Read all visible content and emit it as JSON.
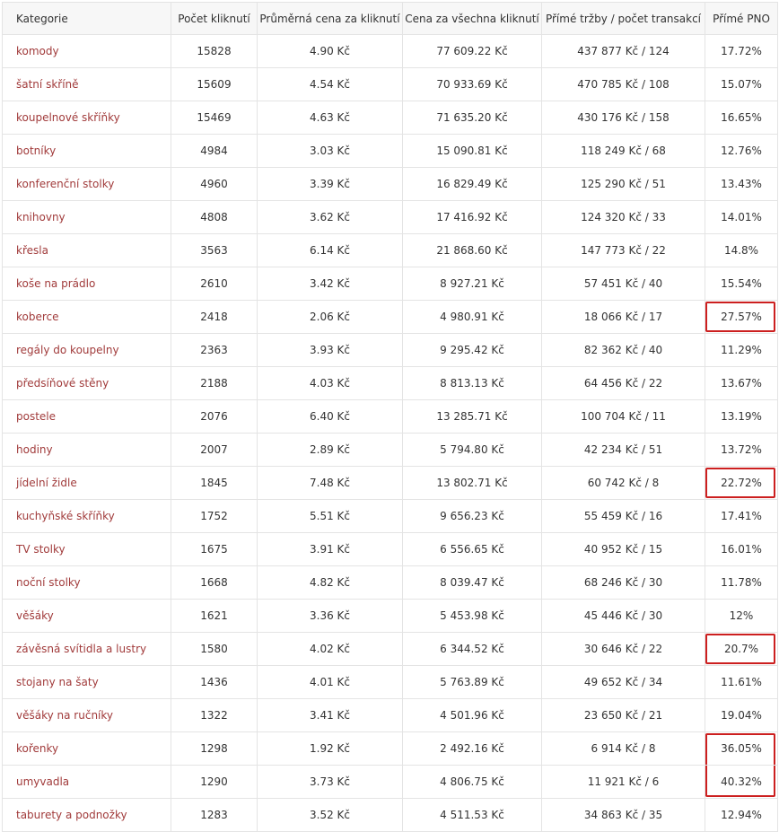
{
  "table": {
    "headers": [
      "Kategorie",
      "Počet kliknutí",
      "Průměrná cena za kliknutí",
      "Cena za všechna kliknutí",
      "Přímé tržby / počet transakcí",
      "Přímé PNO"
    ],
    "highlight_color": "#cc1f1f",
    "link_color": "#a13b3b",
    "rows": [
      {
        "category": "komody",
        "clicks": "15828",
        "avg_cpc": "4.90 Kč",
        "total_cost": "77 609.22 Kč",
        "revenue": "437 877 Kč / 124",
        "pno": "17.72%",
        "highlight": "none"
      },
      {
        "category": "šatní skříně",
        "clicks": "15609",
        "avg_cpc": "4.54 Kč",
        "total_cost": "70 933.69 Kč",
        "revenue": "470 785 Kč / 108",
        "pno": "15.07%",
        "highlight": "none"
      },
      {
        "category": "koupelnové skříňky",
        "clicks": "15469",
        "avg_cpc": "4.63 Kč",
        "total_cost": "71 635.20 Kč",
        "revenue": "430 176 Kč / 158",
        "pno": "16.65%",
        "highlight": "none"
      },
      {
        "category": "botníky",
        "clicks": "4984",
        "avg_cpc": "3.03 Kč",
        "total_cost": "15 090.81 Kč",
        "revenue": "118 249 Kč / 68",
        "pno": "12.76%",
        "highlight": "none"
      },
      {
        "category": "konferenční stolky",
        "clicks": "4960",
        "avg_cpc": "3.39 Kč",
        "total_cost": "16 829.49 Kč",
        "revenue": "125 290 Kč / 51",
        "pno": "13.43%",
        "highlight": "none"
      },
      {
        "category": "knihovny",
        "clicks": "4808",
        "avg_cpc": "3.62 Kč",
        "total_cost": "17 416.92 Kč",
        "revenue": "124 320 Kč / 33",
        "pno": "14.01%",
        "highlight": "none"
      },
      {
        "category": "křesla",
        "clicks": "3563",
        "avg_cpc": "6.14 Kč",
        "total_cost": "21 868.60 Kč",
        "revenue": "147 773 Kč / 22",
        "pno": "14.8%",
        "highlight": "none"
      },
      {
        "category": "koše na prádlo",
        "clicks": "2610",
        "avg_cpc": "3.42 Kč",
        "total_cost": "8 927.21 Kč",
        "revenue": "57 451 Kč / 40",
        "pno": "15.54%",
        "highlight": "none"
      },
      {
        "category": "koberce",
        "clicks": "2418",
        "avg_cpc": "2.06 Kč",
        "total_cost": "4 980.91 Kč",
        "revenue": "18 066 Kč / 17",
        "pno": "27.57%",
        "highlight": "single"
      },
      {
        "category": "regály do koupelny",
        "clicks": "2363",
        "avg_cpc": "3.93 Kč",
        "total_cost": "9 295.42 Kč",
        "revenue": "82 362 Kč / 40",
        "pno": "11.29%",
        "highlight": "none"
      },
      {
        "category": "předsíňové stěny",
        "clicks": "2188",
        "avg_cpc": "4.03 Kč",
        "total_cost": "8 813.13 Kč",
        "revenue": "64 456 Kč / 22",
        "pno": "13.67%",
        "highlight": "none"
      },
      {
        "category": "postele",
        "clicks": "2076",
        "avg_cpc": "6.40 Kč",
        "total_cost": "13 285.71 Kč",
        "revenue": "100 704 Kč / 11",
        "pno": "13.19%",
        "highlight": "none"
      },
      {
        "category": "hodiny",
        "clicks": "2007",
        "avg_cpc": "2.89 Kč",
        "total_cost": "5 794.80 Kč",
        "revenue": "42 234 Kč / 51",
        "pno": "13.72%",
        "highlight": "none"
      },
      {
        "category": "jídelní židle",
        "clicks": "1845",
        "avg_cpc": "7.48 Kč",
        "total_cost": "13 802.71 Kč",
        "revenue": "60 742 Kč / 8",
        "pno": "22.72%",
        "highlight": "single"
      },
      {
        "category": "kuchyňské skříňky",
        "clicks": "1752",
        "avg_cpc": "5.51 Kč",
        "total_cost": "9 656.23 Kč",
        "revenue": "55 459 Kč / 16",
        "pno": "17.41%",
        "highlight": "none"
      },
      {
        "category": "TV stolky",
        "clicks": "1675",
        "avg_cpc": "3.91 Kč",
        "total_cost": "6 556.65 Kč",
        "revenue": "40 952 Kč / 15",
        "pno": "16.01%",
        "highlight": "none"
      },
      {
        "category": "noční stolky",
        "clicks": "1668",
        "avg_cpc": "4.82 Kč",
        "total_cost": "8 039.47 Kč",
        "revenue": "68 246 Kč / 30",
        "pno": "11.78%",
        "highlight": "none"
      },
      {
        "category": "věšáky",
        "clicks": "1621",
        "avg_cpc": "3.36 Kč",
        "total_cost": "5 453.98 Kč",
        "revenue": "45 446 Kč / 30",
        "pno": "12%",
        "highlight": "none"
      },
      {
        "category": "závěsná svítidla a lustry",
        "clicks": "1580",
        "avg_cpc": "4.02 Kč",
        "total_cost": "6 344.52 Kč",
        "revenue": "30 646 Kč / 22",
        "pno": "20.7%",
        "highlight": "single"
      },
      {
        "category": "stojany na šaty",
        "clicks": "1436",
        "avg_cpc": "4.01 Kč",
        "total_cost": "5 763.89 Kč",
        "revenue": "49 652 Kč / 34",
        "pno": "11.61%",
        "highlight": "none"
      },
      {
        "category": "věšáky na ručníky",
        "clicks": "1322",
        "avg_cpc": "3.41 Kč",
        "total_cost": "4 501.96 Kč",
        "revenue": "23 650 Kč / 21",
        "pno": "19.04%",
        "highlight": "none"
      },
      {
        "category": "kořenky",
        "clicks": "1298",
        "avg_cpc": "1.92 Kč",
        "total_cost": "2 492.16 Kč",
        "revenue": "6 914 Kč / 8",
        "pno": "36.05%",
        "highlight": "top"
      },
      {
        "category": "umyvadla",
        "clicks": "1290",
        "avg_cpc": "3.73 Kč",
        "total_cost": "4 806.75 Kč",
        "revenue": "11 921 Kč / 6",
        "pno": "40.32%",
        "highlight": "bottom"
      },
      {
        "category": "taburety a podnožky",
        "clicks": "1283",
        "avg_cpc": "3.52 Kč",
        "total_cost": "4 511.53 Kč",
        "revenue": "34 863 Kč / 35",
        "pno": "12.94%",
        "highlight": "none"
      }
    ]
  }
}
